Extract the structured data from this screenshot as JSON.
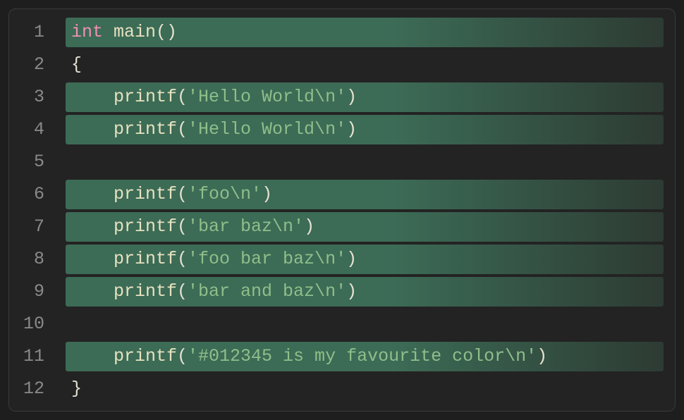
{
  "code": {
    "lines": [
      {
        "num": "1",
        "highlight": true,
        "indent": 1,
        "tokens": [
          {
            "cls": "tok-kw",
            "text": "int"
          },
          {
            "cls": "",
            "text": " "
          },
          {
            "cls": "tok-fn",
            "text": "main"
          },
          {
            "cls": "tok-paren",
            "text": "()"
          }
        ]
      },
      {
        "num": "2",
        "highlight": false,
        "indent": 1,
        "tokens": [
          {
            "cls": "tok-brace",
            "text": "{"
          }
        ]
      },
      {
        "num": "3",
        "highlight": true,
        "indent": 2,
        "tokens": [
          {
            "cls": "tok-call",
            "text": "printf"
          },
          {
            "cls": "tok-paren",
            "text": "("
          },
          {
            "cls": "tok-str",
            "text": "'Hello World\\n'"
          },
          {
            "cls": "tok-paren",
            "text": ")"
          }
        ]
      },
      {
        "num": "4",
        "highlight": true,
        "indent": 2,
        "tokens": [
          {
            "cls": "tok-call",
            "text": "printf"
          },
          {
            "cls": "tok-paren",
            "text": "("
          },
          {
            "cls": "tok-str",
            "text": "'Hello World\\n'"
          },
          {
            "cls": "tok-paren",
            "text": ")"
          }
        ]
      },
      {
        "num": "5",
        "highlight": false,
        "indent": 2,
        "tokens": []
      },
      {
        "num": "6",
        "highlight": true,
        "indent": 2,
        "tokens": [
          {
            "cls": "tok-call",
            "text": "printf"
          },
          {
            "cls": "tok-paren",
            "text": "("
          },
          {
            "cls": "tok-str",
            "text": "'foo\\n'"
          },
          {
            "cls": "tok-paren",
            "text": ")"
          }
        ]
      },
      {
        "num": "7",
        "highlight": true,
        "indent": 2,
        "tokens": [
          {
            "cls": "tok-call",
            "text": "printf"
          },
          {
            "cls": "tok-paren",
            "text": "("
          },
          {
            "cls": "tok-str",
            "text": "'bar baz\\n'"
          },
          {
            "cls": "tok-paren",
            "text": ")"
          }
        ]
      },
      {
        "num": "8",
        "highlight": true,
        "indent": 2,
        "tokens": [
          {
            "cls": "tok-call",
            "text": "printf"
          },
          {
            "cls": "tok-paren",
            "text": "("
          },
          {
            "cls": "tok-str",
            "text": "'foo bar baz\\n'"
          },
          {
            "cls": "tok-paren",
            "text": ")"
          }
        ]
      },
      {
        "num": "9",
        "highlight": true,
        "indent": 2,
        "tokens": [
          {
            "cls": "tok-call",
            "text": "printf"
          },
          {
            "cls": "tok-paren",
            "text": "("
          },
          {
            "cls": "tok-str",
            "text": "'bar and baz\\n'"
          },
          {
            "cls": "tok-paren",
            "text": ")"
          }
        ]
      },
      {
        "num": "10",
        "highlight": false,
        "indent": 2,
        "tokens": []
      },
      {
        "num": "11",
        "highlight": true,
        "indent": 2,
        "tokens": [
          {
            "cls": "tok-call",
            "text": "printf"
          },
          {
            "cls": "tok-paren",
            "text": "("
          },
          {
            "cls": "tok-str",
            "text": "'#012345 is my favourite color\\n'"
          },
          {
            "cls": "tok-paren",
            "text": ")"
          }
        ]
      },
      {
        "num": "12",
        "highlight": false,
        "indent": 1,
        "tokens": [
          {
            "cls": "tok-brace",
            "text": "}"
          }
        ]
      }
    ]
  }
}
